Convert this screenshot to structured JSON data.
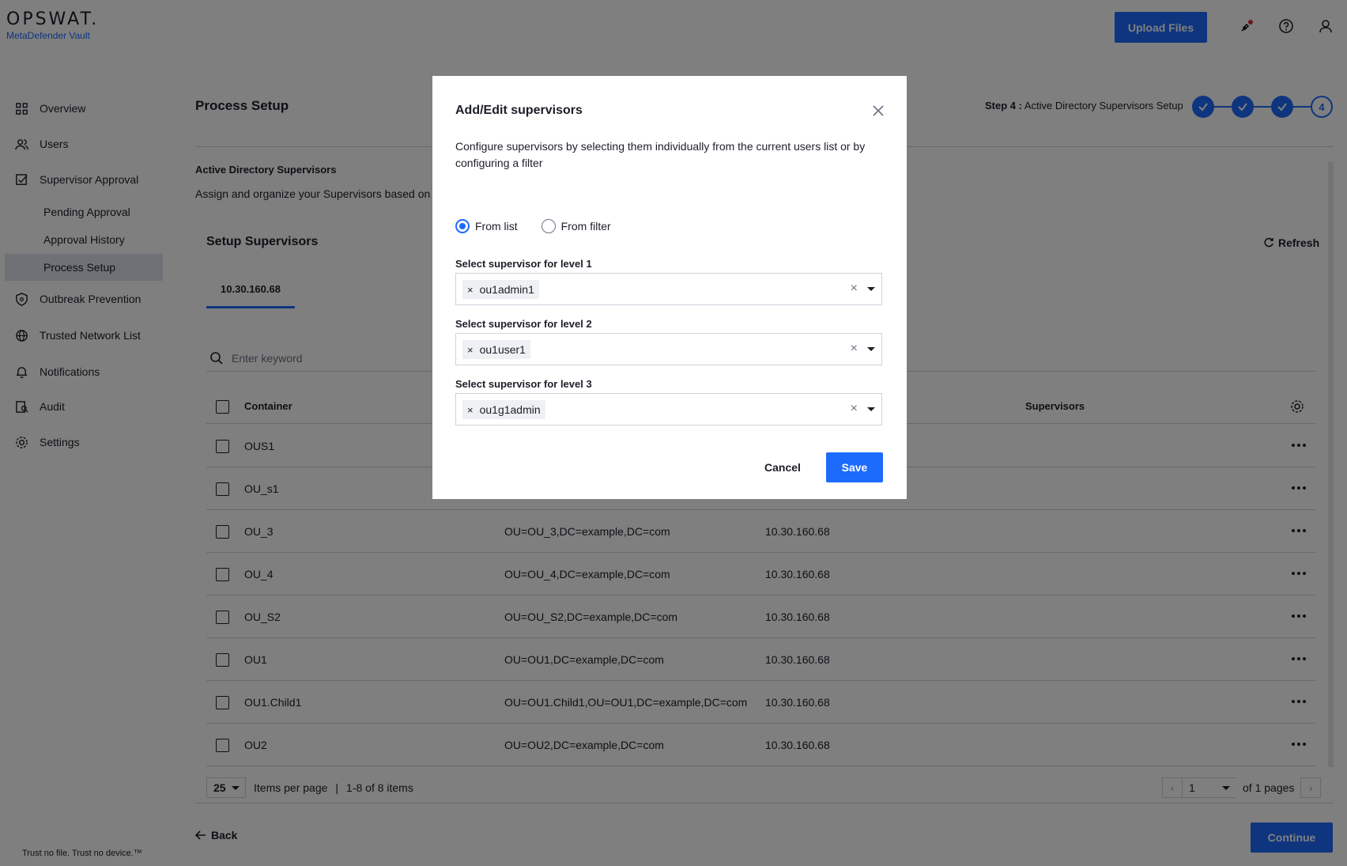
{
  "header": {
    "logo": "OPSWAT.",
    "product": "MetaDefender Vault",
    "upload_label": "Upload Files"
  },
  "sidebar": {
    "items": [
      {
        "label": "Overview",
        "icon": "grid-icon"
      },
      {
        "label": "Users",
        "icon": "users-icon"
      },
      {
        "label": "Supervisor Approval",
        "icon": "checklist-icon"
      },
      {
        "label": "Pending Approval"
      },
      {
        "label": "Approval History"
      },
      {
        "label": "Process Setup"
      },
      {
        "label": "Outbreak Prevention",
        "icon": "shield-icon"
      },
      {
        "label": "Trusted Network List",
        "icon": "globe-icon"
      },
      {
        "label": "Notifications",
        "icon": "bell-icon"
      },
      {
        "label": "Audit",
        "icon": "audit-icon"
      },
      {
        "label": "Settings",
        "icon": "gear-icon"
      }
    ],
    "active": "Process Setup",
    "tagline": "Trust no file. Trust no device.™"
  },
  "main": {
    "title": "Process Setup",
    "step_prefix": "Step 4 :",
    "step_name": "Active Directory Supervisors Setup",
    "current_step": "4",
    "section_title": "Active Directory Supervisors",
    "section_desc": "Assign and organize your Supervisors based on you",
    "setup_title": "Setup Supervisors",
    "refresh_label": "Refresh",
    "tab_label": "10.30.160.68",
    "search_placeholder": "Enter keyword",
    "columns": {
      "container": "Container",
      "supervisors": "Supervisors"
    },
    "rows": [
      {
        "container": "OUS1",
        "dn": "",
        "server": ""
      },
      {
        "container": "OU_s1",
        "dn": "",
        "server": ""
      },
      {
        "container": "OU_3",
        "dn": "OU=OU_3,DC=example,DC=com",
        "server": "10.30.160.68"
      },
      {
        "container": "OU_4",
        "dn": "OU=OU_4,DC=example,DC=com",
        "server": "10.30.160.68"
      },
      {
        "container": "OU_S2",
        "dn": "OU=OU_S2,DC=example,DC=com",
        "server": "10.30.160.68"
      },
      {
        "container": "OU1",
        "dn": "OU=OU1,DC=example,DC=com",
        "server": "10.30.160.68"
      },
      {
        "container": "OU1.Child1",
        "dn": "OU=OU1.Child1,OU=OU1,DC=example,DC=com",
        "server": "10.30.160.68"
      },
      {
        "container": "OU2",
        "dn": "OU=OU2,DC=example,DC=com",
        "server": "10.30.160.68"
      }
    ],
    "per_page": "25",
    "per_page_label": "Items per page",
    "separator": "|",
    "range_label": "1-8 of 8 items",
    "page": "1",
    "of_pages": "of 1 pages",
    "back_label": "Back",
    "continue_label": "Continue"
  },
  "modal": {
    "title": "Add/Edit supervisors",
    "description": "Configure supervisors by selecting them individually from the current users list or by configuring a filter",
    "radio_list": "From list",
    "radio_filter": "From filter",
    "selected_mode": "From list",
    "levels": [
      {
        "label": "Select supervisor for level 1",
        "value": "ou1admin1"
      },
      {
        "label": "Select supervisor for level 2",
        "value": "ou1user1"
      },
      {
        "label": "Select supervisor for level 3",
        "value": "ou1g1admin"
      }
    ],
    "cancel_label": "Cancel",
    "save_label": "Save"
  },
  "colors": {
    "accent": "#1d6bfc",
    "overlay": "rgba(0,0,0,0.5)"
  }
}
